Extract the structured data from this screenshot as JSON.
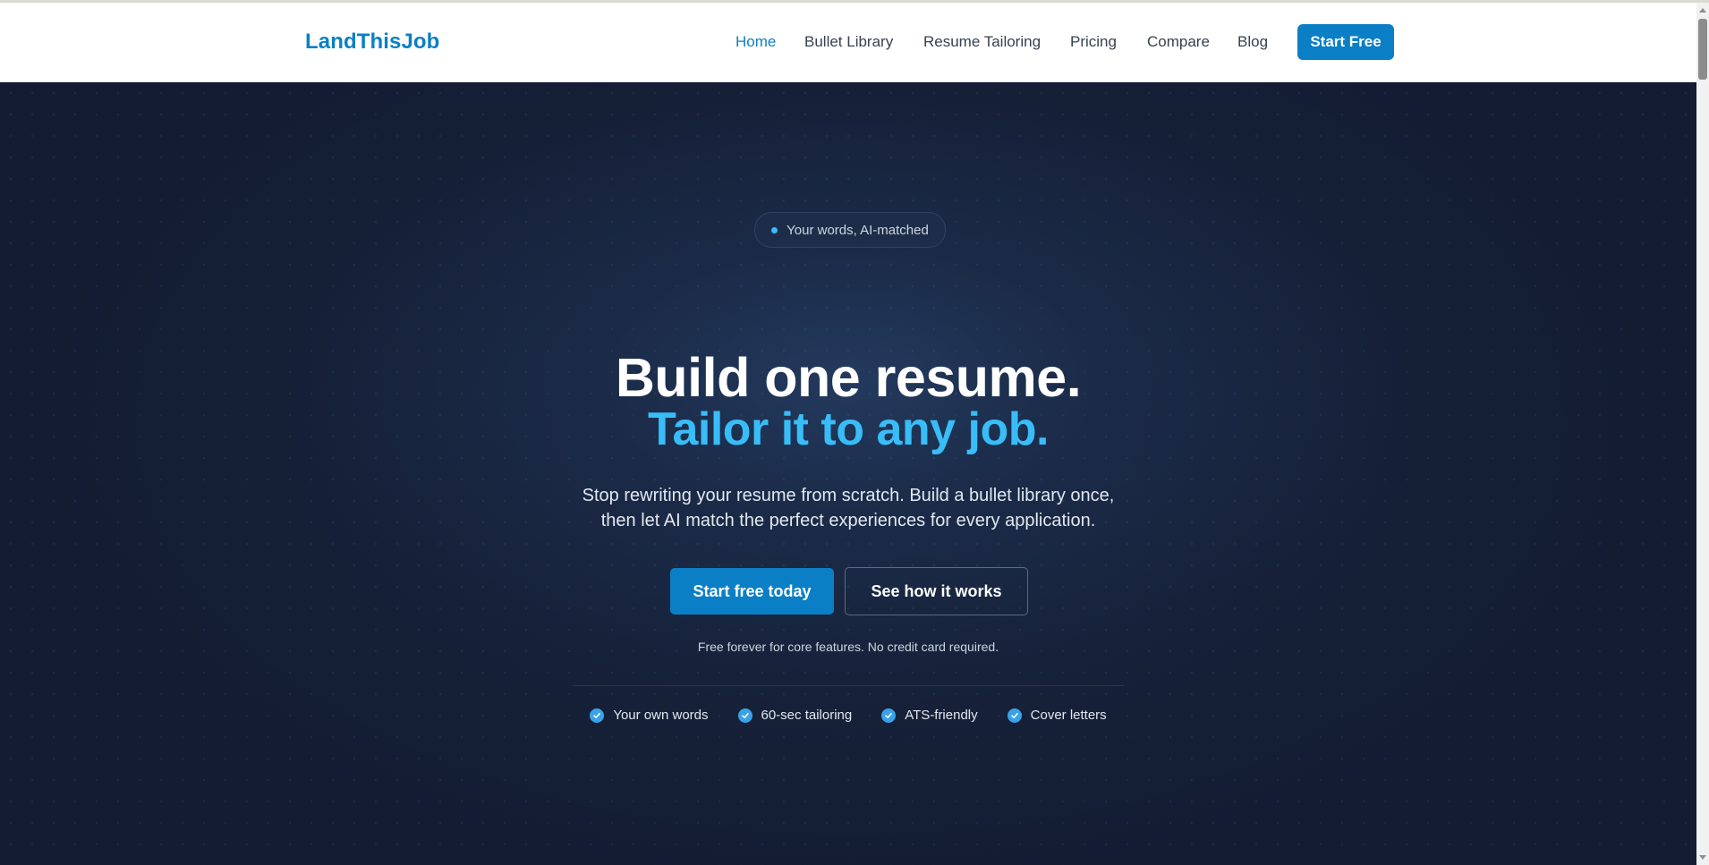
{
  "nav": {
    "brand": "LandThisJob",
    "links": [
      {
        "label": "Home",
        "active": true
      },
      {
        "label": "Bullet Library",
        "active": false
      },
      {
        "label": "Resume Tailoring",
        "active": false
      },
      {
        "label": "Pricing",
        "active": false
      },
      {
        "label": "Compare",
        "active": false
      },
      {
        "label": "Blog",
        "active": false
      }
    ],
    "cta": "Start Free"
  },
  "hero": {
    "badge": "Your words, AI-matched",
    "headline_line1": "Build one resume.",
    "headline_line2": "Tailor it to any job.",
    "subtitle_line1": "Stop rewriting your resume from scratch. Build a bullet library once,",
    "subtitle_line2": "then let AI match the perfect experiences for every application.",
    "primary_cta": "Start free today",
    "secondary_cta": "See how it works",
    "note": "Free forever for core features. No credit card required.",
    "features": [
      "Your own words",
      "60-sec tailoring",
      "ATS-friendly",
      "Cover letters"
    ]
  },
  "colors": {
    "brand": "#0b7fc5",
    "accent": "#38bdf8",
    "hero_bg": "#131c31"
  },
  "icons": {
    "feature_check": "check-circle-icon",
    "badge_dot": "dot-icon"
  }
}
